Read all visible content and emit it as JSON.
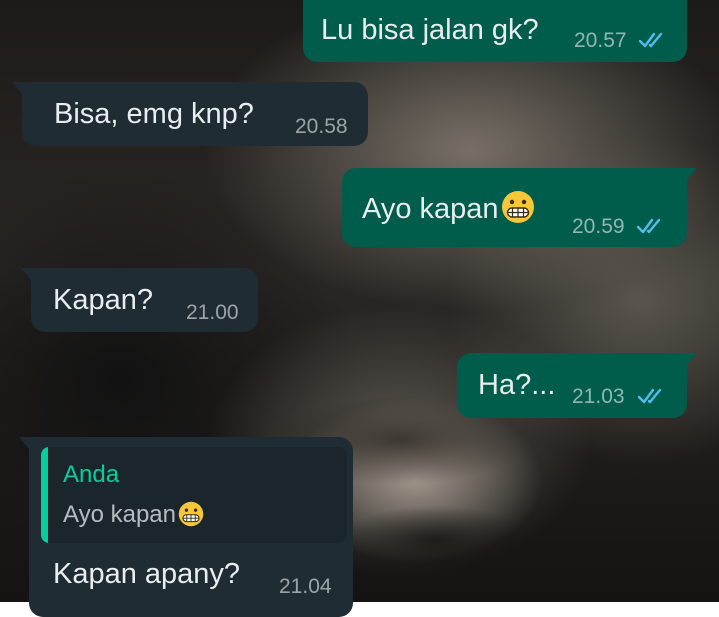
{
  "colors": {
    "outgoing_bubble": "#005c4b",
    "incoming_bubble": "#1f2c34",
    "read_ticks": "#53bdeb",
    "quote_sender": "#06cf9c"
  },
  "messages": [
    {
      "direction": "out",
      "text": "Lu bisa jalan gk?",
      "time": "20.57",
      "status_icon": "double-check-read-icon"
    },
    {
      "direction": "in",
      "text": "Bisa, emg knp?",
      "time": "20.58"
    },
    {
      "direction": "out",
      "text": "Ayo kapan",
      "emoji": "grimacing-face-icon",
      "time": "20.59",
      "status_icon": "double-check-read-icon"
    },
    {
      "direction": "in",
      "text": "Kapan?",
      "time": "21.00"
    },
    {
      "direction": "out",
      "text": "Ha?...",
      "time": "21.03",
      "status_icon": "double-check-read-icon"
    },
    {
      "direction": "in",
      "quoted": {
        "sender": "Anda",
        "text": "Ayo kapan",
        "emoji": "grimacing-face-icon"
      },
      "text": "Kapan apany?",
      "time": "21.04"
    }
  ]
}
